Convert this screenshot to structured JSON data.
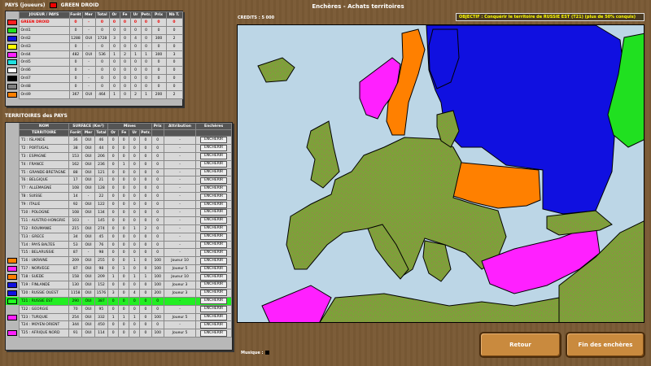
{
  "players_section": {
    "title": "PAYS (joueurs)",
    "current_player": "GREEN DROID",
    "headers": [
      "JOUEUR / PAYS",
      "Forêt",
      "Mer",
      "Total",
      "Or",
      "Fe",
      "Ur",
      "Petr.",
      "Prix",
      "Nb T."
    ],
    "rows": [
      {
        "color": "#ff2020",
        "name": "GREEN DROID",
        "cells": [
          "0",
          "-",
          "0",
          "0",
          "0",
          "0",
          "0",
          "0",
          "0"
        ],
        "me": true
      },
      {
        "color": "#20e020",
        "name": "Ordi1",
        "cells": [
          "0",
          "-",
          "0",
          "0",
          "0",
          "0",
          "0",
          "0",
          "0"
        ]
      },
      {
        "color": "#1010e0",
        "name": "Ordi2",
        "cells": [
          "1288",
          "OUI",
          "1728",
          "3",
          "0",
          "4",
          "0",
          "300",
          "2"
        ]
      },
      {
        "color": "#ffff00",
        "name": "Ordi3",
        "cells": [
          "0",
          "-",
          "0",
          "0",
          "0",
          "0",
          "0",
          "0",
          "0"
        ]
      },
      {
        "color": "#ff20ff",
        "name": "Ordi4",
        "cells": [
          "482",
          "OUI",
          "536",
          "1",
          "2",
          "1",
          "1",
          "300",
          "3"
        ]
      },
      {
        "color": "#20e0e0",
        "name": "Ordi5",
        "cells": [
          "0",
          "-",
          "0",
          "0",
          "0",
          "0",
          "0",
          "0",
          "0"
        ]
      },
      {
        "color": "#ffffff",
        "name": "Ordi6",
        "cells": [
          "0",
          "-",
          "0",
          "0",
          "0",
          "0",
          "0",
          "0",
          "0"
        ]
      },
      {
        "color": "#000000",
        "name": "Ordi7",
        "cells": [
          "0",
          "-",
          "0",
          "0",
          "0",
          "0",
          "0",
          "0",
          "0"
        ]
      },
      {
        "color": "#808080",
        "name": "Ordi8",
        "cells": [
          "0",
          "-",
          "0",
          "0",
          "0",
          "0",
          "0",
          "0",
          "0"
        ]
      },
      {
        "color": "#ff8000",
        "name": "Ordi9",
        "cells": [
          "367",
          "OUI",
          "464",
          "1",
          "0",
          "2",
          "1",
          "200",
          "2"
        ]
      }
    ]
  },
  "territories_section": {
    "title": "TERRITOIRES des PAYS",
    "group_headers": [
      "NOM",
      "SURFACE (Km²)",
      "Mines",
      "Prix",
      "Attribution",
      "Enchères"
    ],
    "sub_headers": [
      "TERRITOIRE",
      "Forêt",
      "Mer",
      "Total",
      "Or",
      "Fe",
      "Ur",
      "Petr."
    ],
    "bid_label": "ENCHERIR",
    "rows": [
      {
        "color": "",
        "name": "T1 : ISLANDE",
        "cells": [
          "36",
          "OUI",
          "46",
          "0",
          "0",
          "0",
          "0",
          "0"
        ],
        "attr": "-"
      },
      {
        "color": "",
        "name": "T2 : PORTUGAL",
        "cells": [
          "38",
          "OUI",
          "44",
          "0",
          "0",
          "0",
          "0",
          "0"
        ],
        "attr": "-"
      },
      {
        "color": "",
        "name": "T3 : ESPAGNE",
        "cells": [
          "153",
          "OUI",
          "206",
          "0",
          "0",
          "0",
          "0",
          "0"
        ],
        "attr": "-"
      },
      {
        "color": "",
        "name": "T4 : FRANCE",
        "cells": [
          "162",
          "OUI",
          "236",
          "0",
          "1",
          "0",
          "0",
          "0"
        ],
        "attr": "-"
      },
      {
        "color": "",
        "name": "T5 : GRANDE-BRETAGNE",
        "cells": [
          "88",
          "OUI",
          "121",
          "0",
          "0",
          "0",
          "0",
          "0"
        ],
        "attr": "-"
      },
      {
        "color": "",
        "name": "T6 : BELGIQUE",
        "cells": [
          "17",
          "OUI",
          "21",
          "0",
          "0",
          "0",
          "0",
          "0"
        ],
        "attr": "-"
      },
      {
        "color": "",
        "name": "T7 : ALLEMAGNE",
        "cells": [
          "108",
          "OUI",
          "128",
          "0",
          "0",
          "0",
          "0",
          "0"
        ],
        "attr": "-"
      },
      {
        "color": "",
        "name": "T8 : SUISSE",
        "cells": [
          "14",
          "-",
          "22",
          "0",
          "0",
          "0",
          "0",
          "0"
        ],
        "attr": "-"
      },
      {
        "color": "",
        "name": "T9 : ITALIE",
        "cells": [
          "92",
          "OUI",
          "122",
          "0",
          "0",
          "0",
          "0",
          "0"
        ],
        "attr": "-"
      },
      {
        "color": "",
        "name": "T10 : POLOGNE",
        "cells": [
          "108",
          "OUI",
          "134",
          "0",
          "0",
          "0",
          "0",
          "0"
        ],
        "attr": "-"
      },
      {
        "color": "",
        "name": "T11 : AUSTRO-HONGRIE",
        "cells": [
          "103",
          "-",
          "145",
          "0",
          "0",
          "0",
          "0",
          "0"
        ],
        "attr": "-"
      },
      {
        "color": "",
        "name": "T12 : ROUMANIE",
        "cells": [
          "215",
          "OUI",
          "274",
          "0",
          "0",
          "1",
          "2",
          "0"
        ],
        "attr": "-"
      },
      {
        "color": "",
        "name": "T13 : GRECE",
        "cells": [
          "34",
          "OUI",
          "45",
          "0",
          "0",
          "0",
          "0",
          "0"
        ],
        "attr": "-"
      },
      {
        "color": "",
        "name": "T14 : PAYS BALTES",
        "cells": [
          "53",
          "OUI",
          "76",
          "0",
          "0",
          "0",
          "0",
          "0"
        ],
        "attr": "-"
      },
      {
        "color": "",
        "name": "T15 : BELARUSSIE",
        "cells": [
          "87",
          "-",
          "98",
          "0",
          "0",
          "0",
          "0",
          "0"
        ],
        "attr": "-"
      },
      {
        "color": "#ff8000",
        "name": "T16 : UKRAINE",
        "cells": [
          "209",
          "OUI",
          "255",
          "0",
          "0",
          "1",
          "0",
          "100"
        ],
        "attr": "Joueur 10"
      },
      {
        "color": "#ff20ff",
        "name": "T17 : NORVEGE",
        "cells": [
          "87",
          "OUI",
          "98",
          "0",
          "1",
          "0",
          "0",
          "100"
        ],
        "attr": "Joueur 5"
      },
      {
        "color": "#ff8000",
        "name": "T18 : SUEDE",
        "cells": [
          "158",
          "OUI",
          "209",
          "1",
          "0",
          "1",
          "1",
          "100"
        ],
        "attr": "Joueur 10"
      },
      {
        "color": "#1010e0",
        "name": "T19 : FINLANDE",
        "cells": [
          "130",
          "OUI",
          "152",
          "0",
          "0",
          "0",
          "0",
          "100"
        ],
        "attr": "Joueur 3"
      },
      {
        "color": "#1010e0",
        "name": "T20 : RUSSIE OUEST",
        "cells": [
          "1158",
          "OUI",
          "1576",
          "3",
          "0",
          "4",
          "0",
          "200"
        ],
        "attr": "Joueur 3"
      },
      {
        "color": "#20ff20",
        "name": "T21 : RUSSIE EST",
        "cells": [
          "290",
          "OUI",
          "387",
          "0",
          "0",
          "0",
          "0",
          "0"
        ],
        "attr": "-",
        "hl": true
      },
      {
        "color": "",
        "name": "T22 : GEORGIE",
        "cells": [
          "70",
          "OUI",
          "95",
          "0",
          "0",
          "0",
          "0",
          "0"
        ],
        "attr": "-"
      },
      {
        "color": "#ff20ff",
        "name": "T23 : TURQUIE",
        "cells": [
          "254",
          "OUI",
          "332",
          "1",
          "1",
          "1",
          "0",
          "100"
        ],
        "attr": "Joueur 5"
      },
      {
        "color": "",
        "name": "T24 : MOYEN ORIENT",
        "cells": [
          "344",
          "OUI",
          "450",
          "0",
          "0",
          "0",
          "0",
          "0"
        ],
        "attr": "-"
      },
      {
        "color": "#ff20ff",
        "name": "T25 : AFRIQUE NORD",
        "cells": [
          "91",
          "OUI",
          "114",
          "0",
          "0",
          "0",
          "0",
          "100"
        ],
        "attr": "Joueur 5"
      }
    ]
  },
  "header": {
    "title": "Enchères - Achats territoires",
    "credits": "CREDITS : 5 000",
    "objective": "OBJECTIF : Conquérir le territoire de RUSSIE EST (T21) (plus de 50% conquis)"
  },
  "footer": {
    "music_label": "Musique :",
    "back_label": "Retour",
    "end_label": "Fin des enchères"
  },
  "colors": {
    "land": "#7ea03a",
    "sea": "#bcd6e6",
    "blue_player": "#1010e0",
    "magenta_player": "#ff20ff",
    "orange_player": "#ff8000",
    "green_player": "#20e020"
  }
}
